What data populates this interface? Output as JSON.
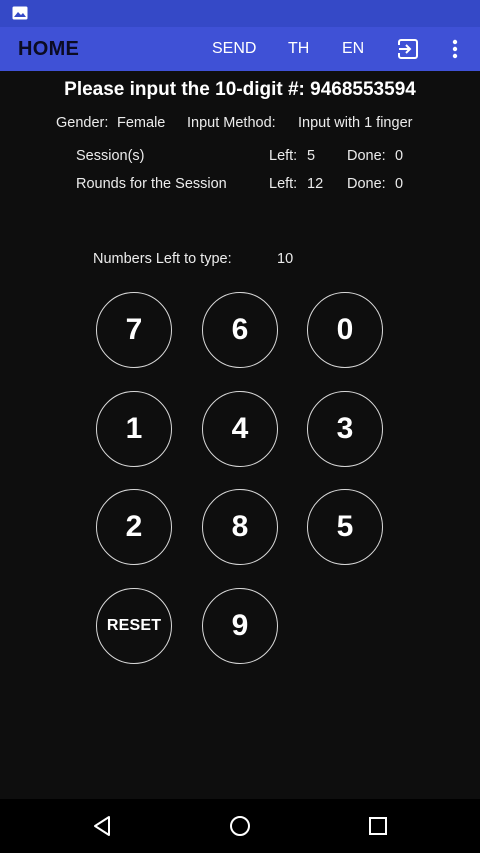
{
  "status_bar": {
    "icon": "image-notification-icon"
  },
  "app_bar": {
    "title": "HOME",
    "actions": {
      "send": "SEND",
      "th": "TH",
      "en": "EN",
      "exit_icon": "exit-to-app-icon",
      "more_icon": "more-vert-icon"
    }
  },
  "prompt": {
    "label": "Please input the 10-digit #:",
    "number": "9468553594"
  },
  "info": {
    "gender_label": "Gender:",
    "gender_value": "Female",
    "method_label": "Input Method:",
    "method_value": "Input with 1 finger"
  },
  "sessions": {
    "label": "Session(s)",
    "left_label": "Left:",
    "left_value": "5",
    "done_label": "Done:",
    "done_value": "0"
  },
  "rounds": {
    "label": "Rounds for the Session",
    "left_label": "Left:",
    "left_value": "12",
    "done_label": "Done:",
    "done_value": "0"
  },
  "remaining": {
    "label": "Numbers Left to type:",
    "value": "10"
  },
  "keypad": {
    "keys": [
      "7",
      "6",
      "0",
      "1",
      "4",
      "3",
      "2",
      "8",
      "5",
      "RESET",
      "9"
    ]
  },
  "nav": {
    "back_icon": "back-triangle-icon",
    "home_icon": "home-circle-icon",
    "recent_icon": "recent-apps-square-icon"
  }
}
